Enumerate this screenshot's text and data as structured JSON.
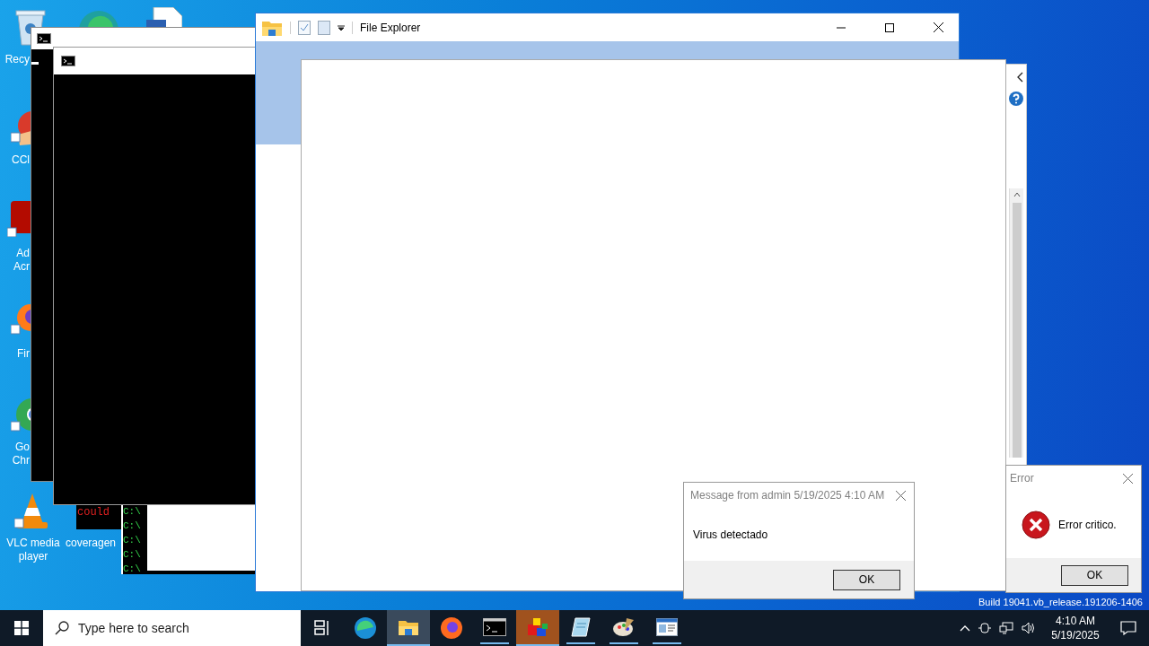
{
  "desktop_icons": [
    {
      "kind": "recycle",
      "label": "Recy"
    },
    {
      "kind": "edge"
    },
    {
      "kind": "document"
    },
    {
      "kind": "ccleaner",
      "label": "CCl"
    },
    {
      "kind": "acrobat",
      "label": "Ad\nAcr"
    },
    {
      "kind": "firefox",
      "label": "Fir"
    },
    {
      "kind": "chrome",
      "label": "Go\nChr"
    },
    {
      "kind": "vlc",
      "label": "VLC media\nplayer"
    },
    {
      "kind": "file",
      "label": "coveragen"
    }
  ],
  "console_fragments": {
    "error_text": "could",
    "prompts": [
      "C:\\",
      "C:\\",
      "C:\\",
      "C:\\",
      "C:\\"
    ]
  },
  "explorer": {
    "title": "File Explorer"
  },
  "message_dialog": {
    "title": "Message from admin 5/19/2025 4:10 AM",
    "text": "Virus detectado",
    "button": "OK"
  },
  "error_dialog": {
    "title": "Error",
    "text": "Error critico.",
    "button": "OK"
  },
  "build_text": "Build 19041.vb_release.191206-1406",
  "taskbar": {
    "search": {
      "placeholder": "Type here to search"
    },
    "apps": [
      {
        "kind": "taskview",
        "selected": false,
        "running": false,
        "flashing": false
      },
      {
        "kind": "edge",
        "selected": false,
        "running": false,
        "flashing": false
      },
      {
        "kind": "explorer",
        "selected": true,
        "running": true,
        "flashing": false
      },
      {
        "kind": "firefox",
        "selected": false,
        "running": false,
        "flashing": false
      },
      {
        "kind": "terminal",
        "selected": false,
        "running": true,
        "flashing": false
      },
      {
        "kind": "cubes",
        "selected": false,
        "running": true,
        "flashing": true
      },
      {
        "kind": "notepad",
        "selected": false,
        "running": true,
        "flashing": false
      },
      {
        "kind": "paint",
        "selected": false,
        "running": true,
        "flashing": false
      },
      {
        "kind": "window",
        "selected": false,
        "running": true,
        "flashing": false
      }
    ],
    "time": "4:10 AM",
    "date": "5/19/2025"
  }
}
